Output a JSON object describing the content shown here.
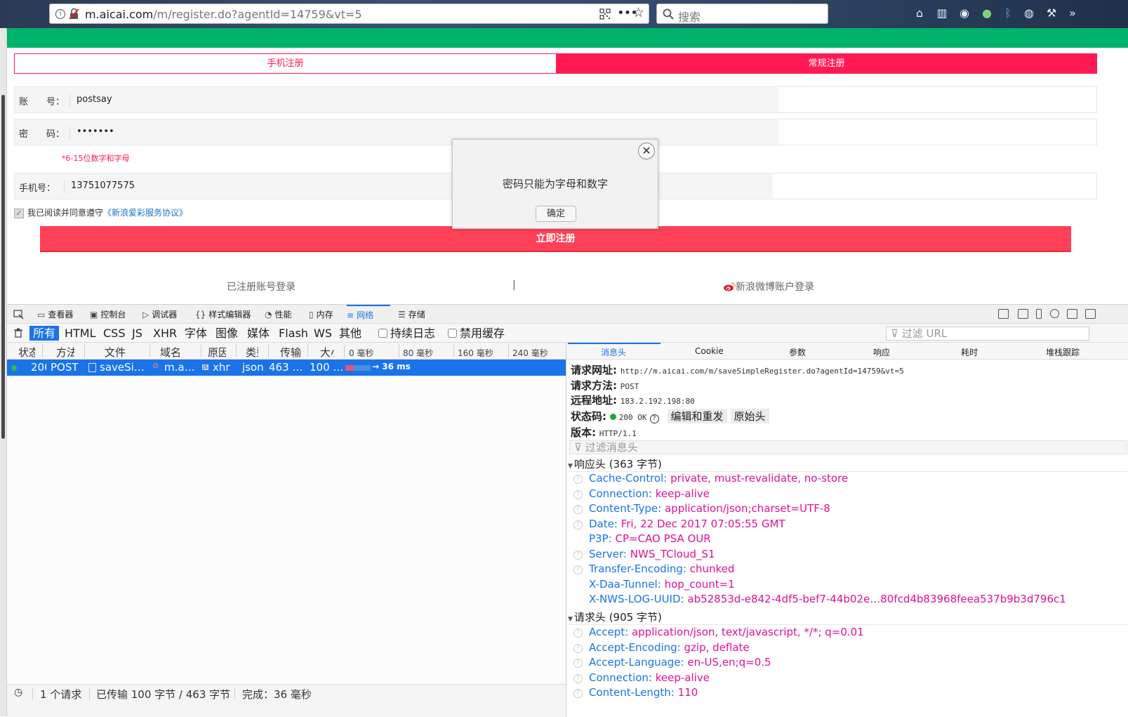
{
  "browser": {
    "url_host": "m.aicai.com",
    "url_path": "/m/register.do?agentId=14759&vt=5",
    "search_placeholder": "搜索"
  },
  "page": {
    "tabs": {
      "phone": "手机注册",
      "normal": "常规注册"
    },
    "account": {
      "label": "账　　号：",
      "value": "postsay"
    },
    "password": {
      "label": "密　　码：",
      "value": "•••••••"
    },
    "password_hint": "*6-15位数字和字母",
    "phone": {
      "label": "手机号：",
      "value": "13751077575"
    },
    "agree_text": "我已阅读并同意遵守",
    "agree_link": "《新浪爱彩服务协议》",
    "register_button": "立即注册",
    "login_link": "已注册账号登录",
    "separator": "|",
    "weibo_link": "新浪微博账户登录"
  },
  "modal": {
    "message": "密码只能为字母和数字",
    "ok_label": "确定",
    "close": "✕"
  },
  "devtools": {
    "tabs": [
      "查看器",
      "控制台",
      "调试器",
      "样式编辑器",
      "性能",
      "内存",
      "网络",
      "存储"
    ],
    "filter_tabs": [
      "所有",
      "HTML",
      "CSS",
      "JS",
      "XHR",
      "字体",
      "图像",
      "媒体",
      "Flash",
      "WS",
      "其他"
    ],
    "persist_log": "持续日志",
    "disable_cache": "禁用缓存",
    "url_filter_placeholder": "过滤 URL",
    "columns": [
      "状态",
      "方法",
      "文件",
      "域名",
      "原因",
      "类型",
      "传输",
      "大小"
    ],
    "ticks": [
      "0 毫秒",
      "80 毫秒",
      "160 毫秒",
      "240 毫秒"
    ],
    "request": {
      "status": "200",
      "method": "POST",
      "file": "saveSi…",
      "domain": "m.a…",
      "cause": "xhr",
      "type": "json",
      "transferred": "463 …",
      "size": "100 …",
      "time": "→ 36 ms"
    },
    "status_bar": {
      "requests": "1 个请求",
      "transferred": "已传输 100 字节 / 463 字节",
      "finish": "完成：36 毫秒"
    },
    "details": {
      "tabs": [
        "消息头",
        "Cookie",
        "参数",
        "响应",
        "耗时",
        "堆栈跟踪"
      ],
      "request_url_label": "请求网址:",
      "request_url": "http://m.aicai.com/m/saveSimpleRegister.do?agentId=14759&vt=5",
      "request_method_label": "请求方法:",
      "request_method": "POST",
      "remote_label": "远程地址:",
      "remote": "183.2.192.198:80",
      "status_label": "状态码:",
      "status": "200 OK",
      "edit_resend": "编辑和重发",
      "raw_headers": "原始头",
      "version_label": "版本:",
      "version": "HTTP/1.1",
      "filter_headers": "过滤消息头",
      "response_title": "响应头 (363 字节)",
      "response_headers": [
        {
          "k": "Cache-Control:",
          "v": "private, must-revalidate, no-store",
          "q": true
        },
        {
          "k": "Connection:",
          "v": "keep-alive",
          "q": true
        },
        {
          "k": "Content-Type:",
          "v": "application/json;charset=UTF-8",
          "q": true
        },
        {
          "k": "Date:",
          "v": "Fri, 22 Dec 2017 07:05:55 GMT",
          "q": true
        },
        {
          "k": "P3P:",
          "v": "CP=CAO PSA OUR",
          "q": false
        },
        {
          "k": "Server:",
          "v": "NWS_TCloud_S1",
          "q": true
        },
        {
          "k": "Transfer-Encoding:",
          "v": "chunked",
          "q": true
        },
        {
          "k": "X-Daa-Tunnel:",
          "v": "hop_count=1",
          "q": false
        },
        {
          "k": "X-NWS-LOG-UUID:",
          "v": "ab52853d-e842-4df5-bef7-44b02e…80fcd4b83968feea537b9b3d796c1",
          "q": false
        }
      ],
      "request_title": "请求头 (905 字节)",
      "request_headers": [
        {
          "k": "Accept:",
          "v": "application/json, text/javascript, */*; q=0.01",
          "q": true
        },
        {
          "k": "Accept-Encoding:",
          "v": "gzip, deflate",
          "q": true
        },
        {
          "k": "Accept-Language:",
          "v": "en-US,en;q=0.5",
          "q": true
        },
        {
          "k": "Connection:",
          "v": "keep-alive",
          "q": true
        },
        {
          "k": "Content-Length:",
          "v": "110",
          "q": true
        }
      ]
    }
  },
  "colors": {
    "brand_green": "#00b36b",
    "accent_pink": "#ff1a53",
    "register_red": "#fe4157",
    "devtools_blue": "#1a73e8"
  }
}
